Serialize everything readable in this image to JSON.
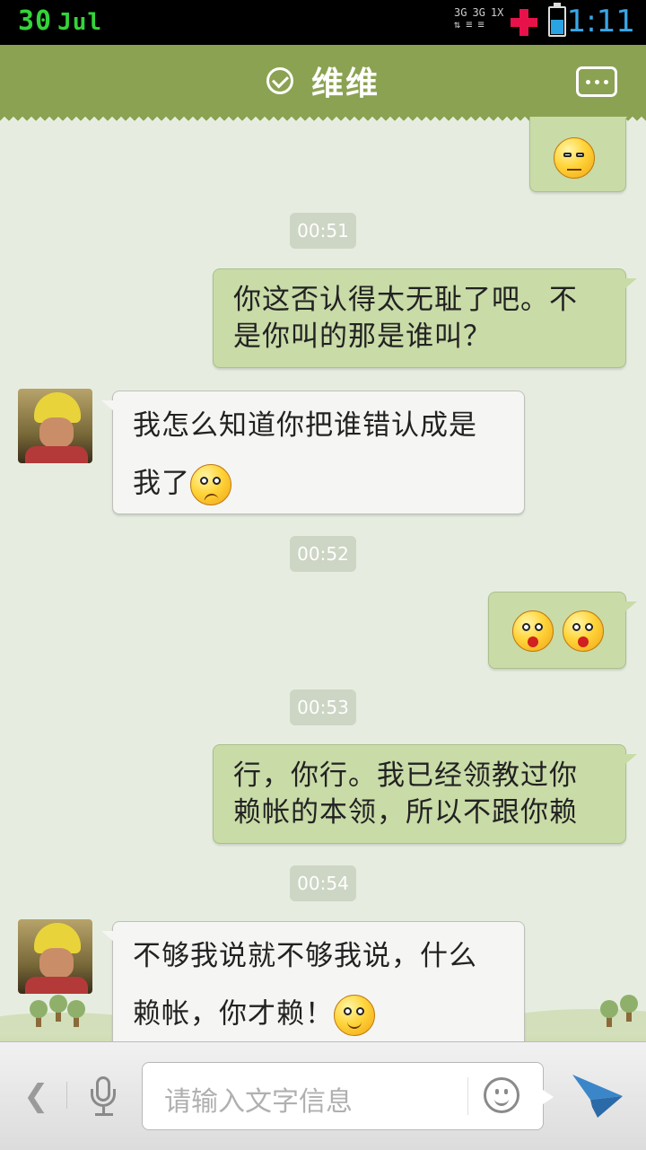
{
  "status_bar": {
    "date_day": "30",
    "date_month": "Jul",
    "network_1": "3G",
    "network_2": "3G",
    "network_3": "1X",
    "time": "1:11"
  },
  "header": {
    "title": "维维"
  },
  "colors": {
    "header_bg": "#8ba252",
    "outgoing_bubble": "#c9dba7",
    "incoming_bubble": "#f5f5f3",
    "chat_bg": "#e6ede0",
    "send_icon": "#3b86c9"
  },
  "messages": [
    {
      "type": "outgoing",
      "emojis": [
        "meh-emoji"
      ]
    },
    {
      "type": "timestamp",
      "text": "00:51"
    },
    {
      "type": "outgoing",
      "text": "你这否认得太无耻了吧。不是你叫的那是谁叫？"
    },
    {
      "type": "incoming",
      "text": "我怎么知道你把谁错认成是我了",
      "emojis": [
        "confused-emoji"
      ]
    },
    {
      "type": "timestamp",
      "text": "00:52"
    },
    {
      "type": "outgoing",
      "emojis": [
        "shocked-emoji",
        "shocked-emoji"
      ]
    },
    {
      "type": "timestamp",
      "text": "00:53"
    },
    {
      "type": "outgoing",
      "text": "行，你行。我已经领教过你赖帐的本领，所以不跟你赖"
    },
    {
      "type": "timestamp",
      "text": "00:54"
    },
    {
      "type": "incoming",
      "text": "不够我说就不够我说，什么赖帐，你才赖！",
      "emojis": [
        "smile-emoji"
      ]
    }
  ],
  "msg_text": {
    "m2_line1": "你这否认得太无耻了吧。不",
    "m2_line2": "是你叫的那是谁叫？",
    "m3_line1": "我怎么知道你把谁错认成是",
    "m3_line2": "我了",
    "m6_line1": "行，你行。我已经领教过你",
    "m6_line2": "赖帐的本领，所以不跟你赖",
    "m8_line1": "不够我说就不够我说，什么",
    "m8_line2": "赖帐，你才赖！"
  },
  "timestamps": [
    "00:51",
    "00:52",
    "00:53",
    "00:54"
  ],
  "input_bar": {
    "back_icon": "chevron-left-icon",
    "placeholder": "请输入文字信息",
    "emoji_icon": "smiley-icon",
    "send_icon": "send-arrow-icon",
    "mic_icon": "microphone-icon"
  }
}
